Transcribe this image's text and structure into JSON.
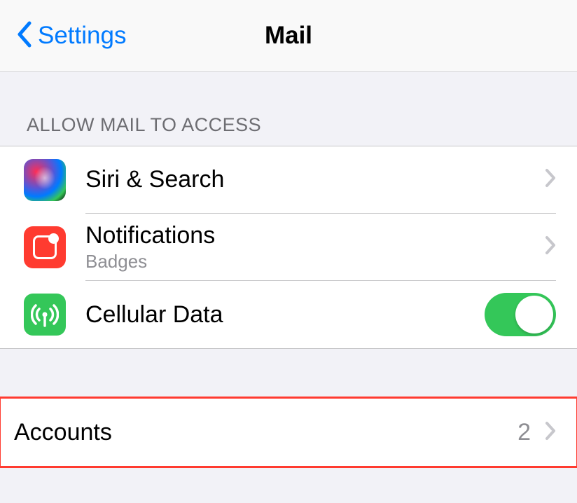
{
  "nav": {
    "back_label": "Settings",
    "title": "Mail"
  },
  "sections": {
    "access": {
      "header": "Allow Mail to Access",
      "siri": {
        "label": "Siri & Search"
      },
      "notifications": {
        "label": "Notifications",
        "sublabel": "Badges"
      },
      "cellular": {
        "label": "Cellular Data",
        "toggle_on": true
      }
    },
    "accounts": {
      "label": "Accounts",
      "value": "2"
    }
  }
}
